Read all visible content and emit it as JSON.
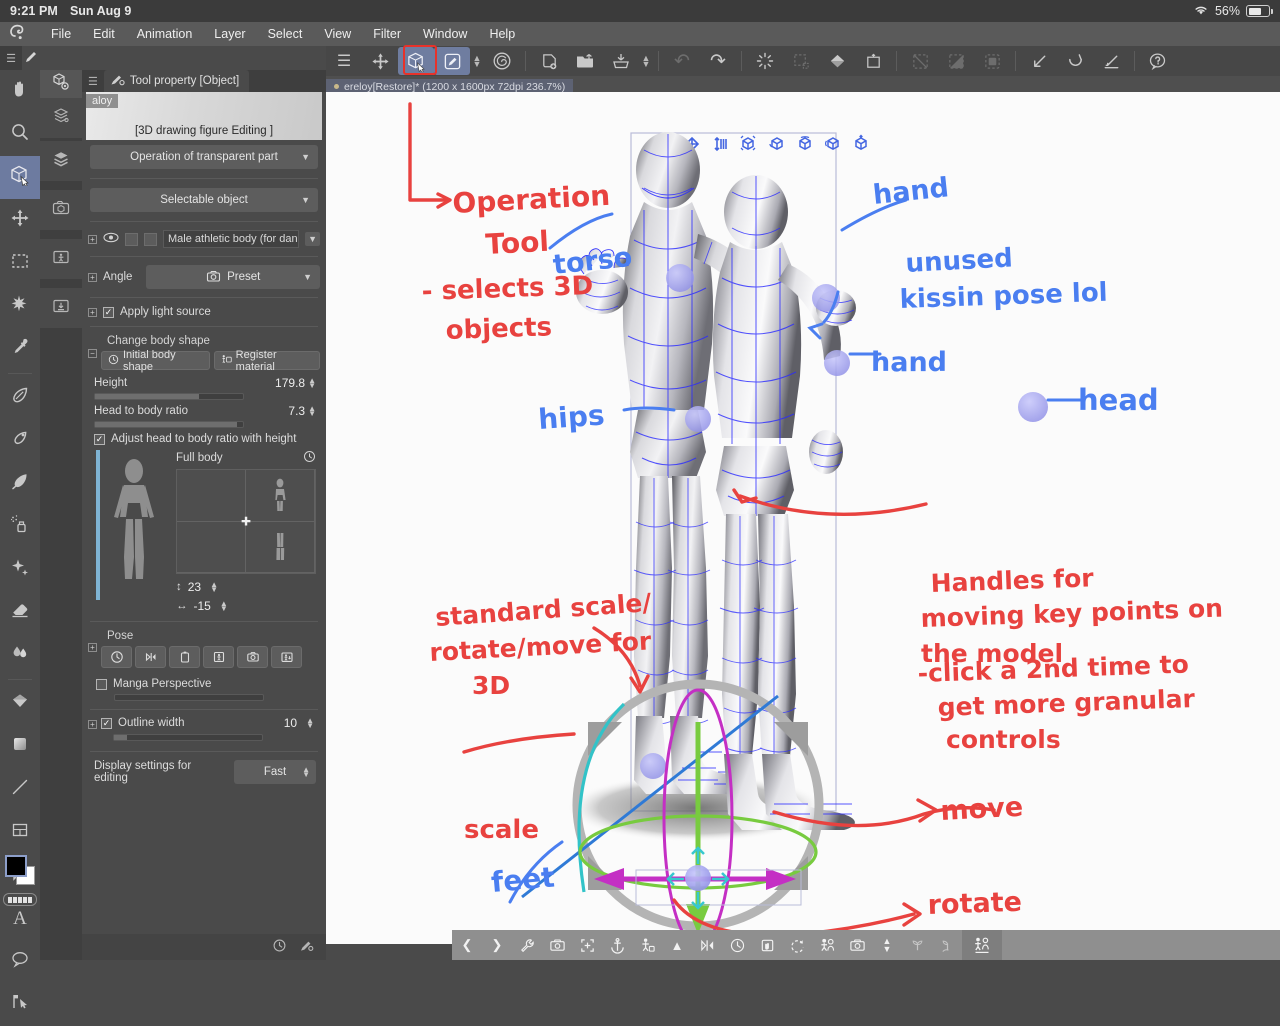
{
  "status_bar": {
    "time": "9:21 PM",
    "date": "Sun Aug 9",
    "wifi_icon": "wifi-icon",
    "battery_percent": "56%"
  },
  "menu_bar": {
    "logo_icon": "clip-studio-logo-icon",
    "items": [
      "File",
      "Edit",
      "Animation",
      "Layer",
      "Select",
      "View",
      "Filter",
      "Window",
      "Help"
    ]
  },
  "top_toolbar": {
    "buttons": [
      {
        "name": "menu-hamburger-icon",
        "glyph": "☰",
        "state": "normal"
      },
      {
        "name": "move-layer-icon",
        "glyph": "✥",
        "state": "normal"
      },
      {
        "name": "object-operation-tool-icon",
        "glyph": "cube-cursor",
        "state": "selected"
      },
      {
        "name": "pen-tool-icon",
        "glyph": "pen-square",
        "state": "selected"
      },
      {
        "name": "brush-size-chevron-icon",
        "glyph": "▴▾",
        "state": "normal"
      },
      {
        "name": "color-wheel-icon",
        "glyph": "spiral",
        "state": "normal"
      },
      {
        "name": "new-layer-icon",
        "glyph": "layer-plus",
        "state": "normal"
      },
      {
        "name": "open-file-icon",
        "glyph": "folder-arrow",
        "state": "normal"
      },
      {
        "name": "save-icon",
        "glyph": "save-tray",
        "state": "normal"
      },
      {
        "name": "save-options-chevron-icon",
        "glyph": "▴▾",
        "state": "normal"
      },
      {
        "name": "undo-icon",
        "glyph": "↶",
        "state": "dim"
      },
      {
        "name": "redo-icon",
        "glyph": "↷",
        "state": "normal"
      },
      {
        "name": "clear-icon",
        "glyph": "sparkle-clear",
        "state": "normal"
      },
      {
        "name": "fill-selection-icon",
        "glyph": "fill-dashed",
        "state": "dim"
      },
      {
        "name": "fill-bucket-icon",
        "glyph": "bucket",
        "state": "normal"
      },
      {
        "name": "crop-icon",
        "glyph": "crop",
        "state": "normal"
      },
      {
        "name": "deselect-icon",
        "glyph": "deselect-dashed",
        "state": "dim"
      },
      {
        "name": "invert-selection-icon",
        "glyph": "invert-dashed",
        "state": "dim"
      },
      {
        "name": "selection-fill-icon",
        "glyph": "rounded-dashed",
        "state": "dim"
      },
      {
        "name": "shrink-selection-icon",
        "glyph": "arrow-corner",
        "state": "normal"
      },
      {
        "name": "smooth-selection-icon",
        "glyph": "curve-scoop",
        "state": "normal"
      },
      {
        "name": "expand-selection-icon",
        "glyph": "arrow-baseline",
        "state": "normal"
      },
      {
        "name": "help-icon",
        "glyph": "question-bubble",
        "state": "normal"
      }
    ],
    "highlight_color": "#e8322a",
    "collapse_chevron_icon": "chevron-down-icon"
  },
  "tool_rail": {
    "hamburger_icon": "hamburger-icon",
    "pen_tab_icon": "pen-icon",
    "items": [
      {
        "name": "hand-tool",
        "icon": "hand-icon",
        "selected": false
      },
      {
        "name": "zoom-tool",
        "icon": "magnifier-icon",
        "selected": false
      },
      {
        "name": "object-tool",
        "icon": "cube-cursor-icon",
        "selected": true
      },
      {
        "name": "move-tool",
        "icon": "four-arrows-icon",
        "selected": false
      },
      {
        "name": "marquee-select-tool",
        "icon": "dashed-rectangle-icon",
        "selected": false
      },
      {
        "name": "auto-select-tool",
        "icon": "magic-wand-icon",
        "selected": false
      },
      {
        "name": "eyedropper-tool",
        "icon": "eyedropper-icon",
        "selected": false
      },
      {
        "name": "pen-tool",
        "icon": "pen-nib-icon",
        "selected": false
      },
      {
        "name": "pencil-tool",
        "icon": "pencil-icon",
        "selected": false
      },
      {
        "name": "brush-tool",
        "icon": "brush-icon",
        "selected": false
      },
      {
        "name": "airbrush-tool",
        "icon": "airbrush-icon",
        "selected": false
      },
      {
        "name": "decoration-tool",
        "icon": "sparkle-icon",
        "selected": false
      },
      {
        "name": "eraser-tool",
        "icon": "eraser-icon",
        "selected": false
      },
      {
        "name": "blend-tool",
        "icon": "blend-drops-icon",
        "selected": false
      },
      {
        "name": "gradient-tool",
        "icon": "gradient-diamond-icon",
        "selected": false
      },
      {
        "name": "fill-tool",
        "icon": "fill-square-icon",
        "selected": false
      },
      {
        "name": "line-tool",
        "icon": "line-icon",
        "selected": false
      },
      {
        "name": "frame-border-tool",
        "icon": "frame-grid-icon",
        "selected": false
      },
      {
        "name": "ruler-tool",
        "icon": "ruler-triangle-icon",
        "selected": false
      },
      {
        "name": "text-tool",
        "icon": "text-a-icon",
        "selected": false
      },
      {
        "name": "balloon-tool",
        "icon": "speech-balloon-icon",
        "selected": false
      },
      {
        "name": "correct-line-tool",
        "icon": "pin-cursor-icon",
        "selected": false
      }
    ],
    "color_swatch": {
      "foreground": "#000000",
      "background": "#ffffff"
    },
    "swatch_strip_icon": "color-set-icon"
  },
  "sub_rail": {
    "top_icon": "material-3d-gear-icon",
    "items": [
      {
        "name": "layer-property-palette",
        "icon": "layers-stack-property-icon"
      },
      {
        "name": "layer-palette",
        "icon": "layers-stack-icon"
      },
      {
        "name": "material-3d-palette",
        "icon": "camera-cube-icon"
      },
      {
        "name": "material-pose-palette",
        "icon": "folder-figure-icon"
      },
      {
        "name": "material-download-palette",
        "icon": "folder-download-icon"
      }
    ]
  },
  "tool_property": {
    "tab_icon": "tool-property-icon",
    "tab_title": "Tool property [Object]",
    "hero_chip": "aloy",
    "hero_caption": "[3D drawing figure Editing ]",
    "transparent_part": "Operation of transparent part",
    "selectable_object": "Selectable object",
    "layer_row": {
      "eye_icon": "eye-icon",
      "name": "Male athletic body (for dance p",
      "chevron_icon": "chevron-down-icon"
    },
    "angle_label": "Angle",
    "angle_value": "Preset",
    "angle_icon": "camera-preset-icon",
    "apply_light_source": "Apply light source",
    "apply_light_source_checked": true,
    "change_body_shape": "Change body shape",
    "initial_body_shape": "Initial body shape",
    "register_material": "Register material",
    "height_label": "Height",
    "height_value": "179.8",
    "height_fill_pct": 70,
    "head_ratio_label": "Head to body ratio",
    "head_ratio_value": "7.3",
    "head_ratio_fill_pct": 96,
    "adjust_ratio_label": "Adjust head to body ratio with height",
    "adjust_ratio_checked": true,
    "full_body_label": "Full body",
    "full_body_reset_icon": "reset-clock-icon",
    "vertical_label_icon": "vertical-arrow-icon",
    "vertical_value": "23",
    "horizontal_label_icon": "horizontal-arrow-icon",
    "horizontal_value": "-15",
    "pose_label": "Pose",
    "pose_buttons": [
      {
        "name": "reset-pose-button",
        "icon": "reset-clock-icon"
      },
      {
        "name": "flip-pose-button",
        "icon": "flip-horizontal-icon"
      },
      {
        "name": "copy-pose-button",
        "icon": "clipboard-icon"
      },
      {
        "name": "register-pose-button",
        "icon": "figure-frame-icon"
      },
      {
        "name": "camera-pose-button",
        "icon": "camera-icon"
      },
      {
        "name": "save-pose-button",
        "icon": "figure-save-icon"
      }
    ],
    "manga_perspective_label": "Manga Perspective",
    "manga_perspective_checked": false,
    "outline_width_label": "Outline width",
    "outline_width_checked": true,
    "outline_width_value": "10",
    "outline_width_fill_pct": 8,
    "display_settings_label": "Display settings for editing",
    "display_settings_value": "Fast",
    "bottom_icons": [
      "history-icon",
      "tool-settings-icon"
    ]
  },
  "canvas": {
    "tab_dot": "modified-indicator",
    "tab_title": "ereloy[Restore]* (1200 x 1600px 72dpi 236.7%)",
    "model_toolbar_icons": [
      "rotate-figure-icon",
      "move-figure-icon",
      "move-vertical-icon",
      "scale-cube-icon",
      "camera-cube-icon",
      "rotate-cube-top-icon",
      "rotate-cube-side-icon",
      "reset-cube-icon"
    ],
    "bottom_bar_icons": [
      "prev-icon",
      "next-icon",
      "wrench-icon",
      "camera-fix-icon",
      "fit-frame-icon",
      "anchor-icon",
      "figure-move-icon",
      "up-arrow-icon",
      "flip-icon",
      "reset-clock-icon",
      "hand-pose-icon",
      "rotate-joint-icon",
      "two-figures-icon",
      "camera-icon",
      "updown-chevron-icon",
      "plant-icon",
      "plant-hand-icon"
    ],
    "bottom_bar_right_icon": "figure-pair-icon"
  },
  "annotations": {
    "red": [
      {
        "name": "annotation-operation-tool",
        "lines": [
          "Operation",
          "Tool"
        ]
      },
      {
        "name": "annotation-selects-3d-objects",
        "lines": [
          "- selects 3D",
          "objects"
        ]
      },
      {
        "name": "annotation-standard-scale",
        "lines": [
          "standard scale/",
          "rotate/move for",
          "3D"
        ]
      },
      {
        "name": "annotation-scale",
        "lines": [
          "scale"
        ]
      },
      {
        "name": "annotation-handles",
        "lines": [
          "Handles for",
          "moving key points on",
          "the model"
        ]
      },
      {
        "name": "annotation-click-second-time",
        "lines": [
          "-click a 2nd time to",
          "get more granular",
          "controls"
        ]
      },
      {
        "name": "annotation-move",
        "lines": [
          "move"
        ]
      },
      {
        "name": "annotation-rotate",
        "lines": [
          "rotate"
        ]
      }
    ],
    "blue": [
      {
        "name": "annotation-torso",
        "lines": [
          "torso"
        ]
      },
      {
        "name": "annotation-hand-top",
        "lines": [
          "hand"
        ]
      },
      {
        "name": "annotation-unused-kissin-pose",
        "lines": [
          "unused",
          "kissin pose lol"
        ]
      },
      {
        "name": "annotation-hand-right",
        "lines": [
          "hand"
        ]
      },
      {
        "name": "annotation-head",
        "lines": [
          "head"
        ]
      },
      {
        "name": "annotation-hips",
        "lines": [
          "hips"
        ]
      },
      {
        "name": "annotation-feet",
        "lines": [
          "feet"
        ]
      }
    ],
    "colors": {
      "red": "#e8423f",
      "blue": "#4a7ef0",
      "handle": "#9b9bf0"
    }
  }
}
